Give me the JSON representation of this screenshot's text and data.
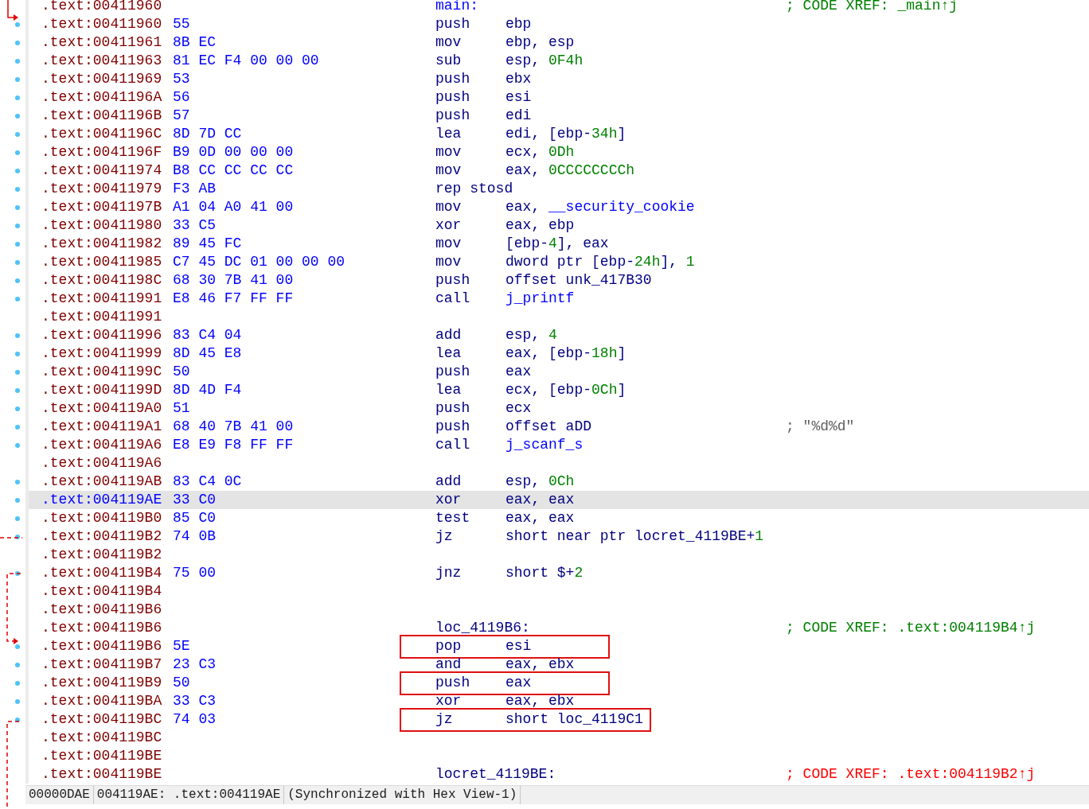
{
  "rows": [
    {
      "address": ".text:00411960",
      "label": {
        "text": "main:",
        "kind": "name"
      },
      "comment": {
        "text": "; CODE XREF: _main↑j",
        "kind": "xref"
      },
      "dot": false,
      "selected": false
    },
    {
      "address": ".text:00411960",
      "bytes": "55",
      "mnemonic": "push",
      "operands": [
        {
          "text": "ebp",
          "kind": "text"
        }
      ],
      "dot": true,
      "selected": false
    },
    {
      "address": ".text:00411961",
      "bytes": "8B EC",
      "mnemonic": "mov",
      "operands": [
        {
          "text": "ebp, esp",
          "kind": "text"
        }
      ],
      "dot": true,
      "selected": false
    },
    {
      "address": ".text:00411963",
      "bytes": "81 EC F4 00 00 00",
      "mnemonic": "sub",
      "operands": [
        {
          "text": "esp, ",
          "kind": "text"
        },
        {
          "text": "0F4h",
          "kind": "num"
        }
      ],
      "dot": true,
      "selected": false
    },
    {
      "address": ".text:00411969",
      "bytes": "53",
      "mnemonic": "push",
      "operands": [
        {
          "text": "ebx",
          "kind": "text"
        }
      ],
      "dot": true,
      "selected": false
    },
    {
      "address": ".text:0041196A",
      "bytes": "56",
      "mnemonic": "push",
      "operands": [
        {
          "text": "esi",
          "kind": "text"
        }
      ],
      "dot": true,
      "selected": false
    },
    {
      "address": ".text:0041196B",
      "bytes": "57",
      "mnemonic": "push",
      "operands": [
        {
          "text": "edi",
          "kind": "text"
        }
      ],
      "dot": true,
      "selected": false
    },
    {
      "address": ".text:0041196C",
      "bytes": "8D 7D CC",
      "mnemonic": "lea",
      "operands": [
        {
          "text": "edi, [ebp-",
          "kind": "text"
        },
        {
          "text": "34h",
          "kind": "num"
        },
        {
          "text": "]",
          "kind": "text"
        }
      ],
      "dot": true,
      "selected": false
    },
    {
      "address": ".text:0041196F",
      "bytes": "B9 0D 00 00 00",
      "mnemonic": "mov",
      "operands": [
        {
          "text": "ecx, ",
          "kind": "text"
        },
        {
          "text": "0Dh",
          "kind": "num"
        }
      ],
      "dot": true,
      "selected": false
    },
    {
      "address": ".text:00411974",
      "bytes": "B8 CC CC CC CC",
      "mnemonic": "mov",
      "operands": [
        {
          "text": "eax, ",
          "kind": "text"
        },
        {
          "text": "0CCCCCCCCh",
          "kind": "num"
        }
      ],
      "dot": true,
      "selected": false
    },
    {
      "address": ".text:00411979",
      "bytes": "F3 AB",
      "mnemonic": "rep stosd",
      "dot": true,
      "selected": false
    },
    {
      "address": ".text:0041197B",
      "bytes": "A1 04 A0 41 00",
      "mnemonic": "mov",
      "operands": [
        {
          "text": "eax, ",
          "kind": "text"
        },
        {
          "text": "__security_cookie",
          "kind": "name"
        }
      ],
      "dot": true,
      "selected": false
    },
    {
      "address": ".text:00411980",
      "bytes": "33 C5",
      "mnemonic": "xor",
      "operands": [
        {
          "text": "eax, ebp",
          "kind": "text"
        }
      ],
      "dot": true,
      "selected": false
    },
    {
      "address": ".text:00411982",
      "bytes": "89 45 FC",
      "mnemonic": "mov",
      "operands": [
        {
          "text": "[ebp-",
          "kind": "text"
        },
        {
          "text": "4",
          "kind": "num"
        },
        {
          "text": "], eax",
          "kind": "text"
        }
      ],
      "dot": true,
      "selected": false
    },
    {
      "address": ".text:00411985",
      "bytes": "C7 45 DC 01 00 00 00",
      "mnemonic": "mov",
      "operands": [
        {
          "text": "dword ptr [ebp-",
          "kind": "text"
        },
        {
          "text": "24h",
          "kind": "num"
        },
        {
          "text": "], ",
          "kind": "text"
        },
        {
          "text": "1",
          "kind": "num"
        }
      ],
      "dot": true,
      "selected": false
    },
    {
      "address": ".text:0041198C",
      "bytes": "68 30 7B 41 00",
      "mnemonic": "push",
      "operands": [
        {
          "text": "offset unk_417B30",
          "kind": "text"
        }
      ],
      "dot": true,
      "selected": false
    },
    {
      "address": ".text:00411991",
      "bytes": "E8 46 F7 FF FF",
      "mnemonic": "call",
      "operands": [
        {
          "text": "j_printf",
          "kind": "name"
        }
      ],
      "dot": true,
      "selected": false
    },
    {
      "address": ".text:00411991",
      "dot": false,
      "selected": false
    },
    {
      "address": ".text:00411996",
      "bytes": "83 C4 04",
      "mnemonic": "add",
      "operands": [
        {
          "text": "esp, ",
          "kind": "text"
        },
        {
          "text": "4",
          "kind": "num"
        }
      ],
      "dot": true,
      "selected": false
    },
    {
      "address": ".text:00411999",
      "bytes": "8D 45 E8",
      "mnemonic": "lea",
      "operands": [
        {
          "text": "eax, [ebp-",
          "kind": "text"
        },
        {
          "text": "18h",
          "kind": "num"
        },
        {
          "text": "]",
          "kind": "text"
        }
      ],
      "dot": true,
      "selected": false
    },
    {
      "address": ".text:0041199C",
      "bytes": "50",
      "mnemonic": "push",
      "operands": [
        {
          "text": "eax",
          "kind": "text"
        }
      ],
      "dot": true,
      "selected": false
    },
    {
      "address": ".text:0041199D",
      "bytes": "8D 4D F4",
      "mnemonic": "lea",
      "operands": [
        {
          "text": "ecx, [ebp-",
          "kind": "text"
        },
        {
          "text": "0Ch",
          "kind": "num"
        },
        {
          "text": "]",
          "kind": "text"
        }
      ],
      "dot": true,
      "selected": false
    },
    {
      "address": ".text:004119A0",
      "bytes": "51",
      "mnemonic": "push",
      "operands": [
        {
          "text": "ecx",
          "kind": "text"
        }
      ],
      "dot": true,
      "selected": false
    },
    {
      "address": ".text:004119A1",
      "bytes": "68 40 7B 41 00",
      "mnemonic": "push",
      "operands": [
        {
          "text": "offset aDD",
          "kind": "text"
        }
      ],
      "comment": {
        "text": "; \"%d%d\"",
        "kind": "string"
      },
      "dot": true,
      "selected": false
    },
    {
      "address": ".text:004119A6",
      "bytes": "E8 E9 F8 FF FF",
      "mnemonic": "call",
      "operands": [
        {
          "text": "j_scanf_s",
          "kind": "name"
        }
      ],
      "dot": true,
      "selected": false
    },
    {
      "address": ".text:004119A6",
      "dot": false,
      "selected": false
    },
    {
      "address": ".text:004119AB",
      "bytes": "83 C4 0C",
      "mnemonic": "add",
      "operands": [
        {
          "text": "esp, ",
          "kind": "text"
        },
        {
          "text": "0Ch",
          "kind": "num"
        }
      ],
      "dot": true,
      "selected": false
    },
    {
      "address": ".text:004119AE",
      "bytes": "33 C0",
      "mnemonic": "xor",
      "operands": [
        {
          "text": "eax, eax",
          "kind": "text"
        }
      ],
      "dot": true,
      "selected": true
    },
    {
      "address": ".text:004119B0",
      "bytes": "85 C0",
      "mnemonic": "test",
      "operands": [
        {
          "text": "eax, eax",
          "kind": "text"
        }
      ],
      "dot": true,
      "selected": false
    },
    {
      "address": ".text:004119B2",
      "bytes": "74 0B",
      "mnemonic": "jz",
      "operands": [
        {
          "text": "short near ptr locret_4119BE+",
          "kind": "text"
        },
        {
          "text": "1",
          "kind": "num"
        }
      ],
      "dot": true,
      "selected": false
    },
    {
      "address": ".text:004119B2",
      "dot": false,
      "selected": false
    },
    {
      "address": ".text:004119B4",
      "bytes": "75 00",
      "mnemonic": "jnz",
      "operands": [
        {
          "text": "short $+",
          "kind": "text"
        },
        {
          "text": "2",
          "kind": "num"
        }
      ],
      "dot": true,
      "selected": false
    },
    {
      "address": ".text:004119B4",
      "dot": false,
      "selected": false
    },
    {
      "address": ".text:004119B6",
      "dot": false,
      "selected": false
    },
    {
      "address": ".text:004119B6",
      "label": {
        "text": "loc_4119B6:",
        "kind": "text"
      },
      "comment": {
        "text": "; CODE XREF: .text:004119B4↑j",
        "kind": "xref"
      },
      "dot": false,
      "selected": false
    },
    {
      "address": ".text:004119B6",
      "bytes": "5E",
      "mnemonic": "pop",
      "operands": [
        {
          "text": "esi",
          "kind": "text"
        }
      ],
      "boxed": true,
      "dot": true,
      "selected": false
    },
    {
      "address": ".text:004119B7",
      "bytes": "23 C3",
      "mnemonic": "and",
      "operands": [
        {
          "text": "eax, ebx",
          "kind": "text"
        }
      ],
      "dot": true,
      "selected": false
    },
    {
      "address": ".text:004119B9",
      "bytes": "50",
      "mnemonic": "push",
      "operands": [
        {
          "text": "eax",
          "kind": "text"
        }
      ],
      "boxed": true,
      "dot": true,
      "selected": false
    },
    {
      "address": ".text:004119BA",
      "bytes": "33 C3",
      "mnemonic": "xor",
      "operands": [
        {
          "text": "eax, ebx",
          "kind": "text"
        }
      ],
      "dot": true,
      "selected": false
    },
    {
      "address": ".text:004119BC",
      "bytes": "74 03",
      "mnemonic": "jz",
      "operands": [
        {
          "text": "short loc_4119C1",
          "kind": "text"
        }
      ],
      "boxed": true,
      "dot": true,
      "selected": false
    },
    {
      "address": ".text:004119BC",
      "dot": false,
      "selected": false
    },
    {
      "address": ".text:004119BE",
      "dot": false,
      "selected": false
    },
    {
      "address": ".text:004119BE",
      "label": {
        "text": "locret_4119BE:",
        "kind": "text"
      },
      "comment": {
        "text": "; CODE XREF: .text:004119B2↑j",
        "kind": "error"
      },
      "dot": false,
      "selected": false
    }
  ],
  "status_bar": [
    "00000DAE",
    "004119AE: .text:004119AE",
    "(Synchronized with Hex View-1)"
  ]
}
